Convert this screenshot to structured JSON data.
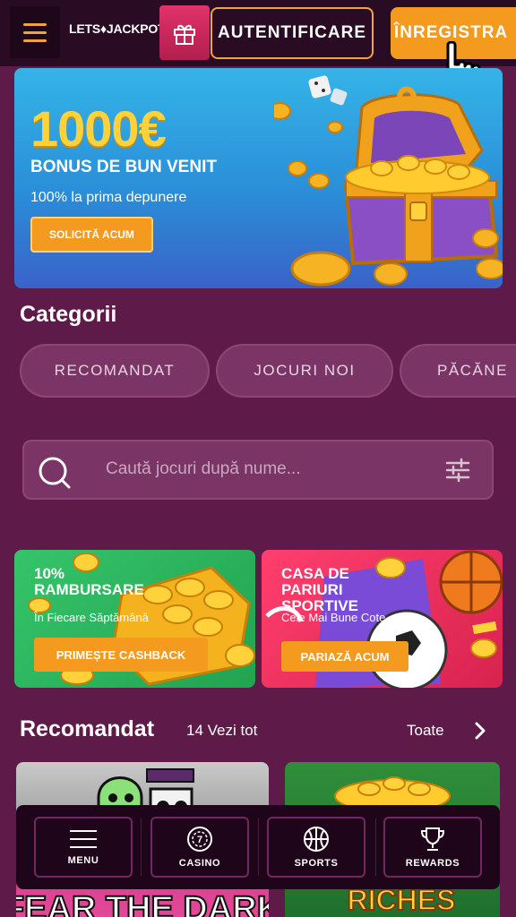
{
  "header": {
    "logo_text": "LETS♦JACKPOT",
    "login_label": "AUTENTIFICARE",
    "register_label": "ÎNREGISTRA"
  },
  "hero": {
    "amount": "1000€",
    "bonus_title": "BONUS DE BUN VENIT",
    "subtitle": "100% la prima depunere",
    "cta_label": "SOLICITĂ ACUM"
  },
  "categories": {
    "title": "Categorii",
    "chips": [
      "RECOMANDAT",
      "JOCURI NOI",
      "PĂCĂNE"
    ]
  },
  "search": {
    "placeholder": "Caută jocuri după nume..."
  },
  "promos": [
    {
      "title": "10% RAMBURSARE",
      "subtitle": "În Fiecare Săptămână",
      "button_label": "PRIMEȘTE CASHBACK"
    },
    {
      "title": "CASA DE PARIURI SPORTIVE",
      "subtitle": "Cele Mai Bune Cote",
      "button_label": "PARIAZĂ ACUM"
    }
  ],
  "recommended": {
    "title": "Recomandat",
    "count_label": "14 Vezi tot",
    "all_label": "Toate"
  },
  "games": [
    {
      "art_text": "FEAR THE DARK"
    },
    {
      "art_text": "RICHES"
    }
  ],
  "bottom_nav": [
    {
      "label": "MENU",
      "icon": "hamburger-icon"
    },
    {
      "label": "CASINO",
      "icon": "casino-chip-icon"
    },
    {
      "label": "SPORTS",
      "icon": "basketball-icon"
    },
    {
      "label": "REWARDS",
      "icon": "trophy-icon"
    }
  ],
  "colors": {
    "background": "#5e1a49",
    "header": "#2a0b24",
    "accent": "#f39a1f",
    "chip": "#7a3465"
  }
}
